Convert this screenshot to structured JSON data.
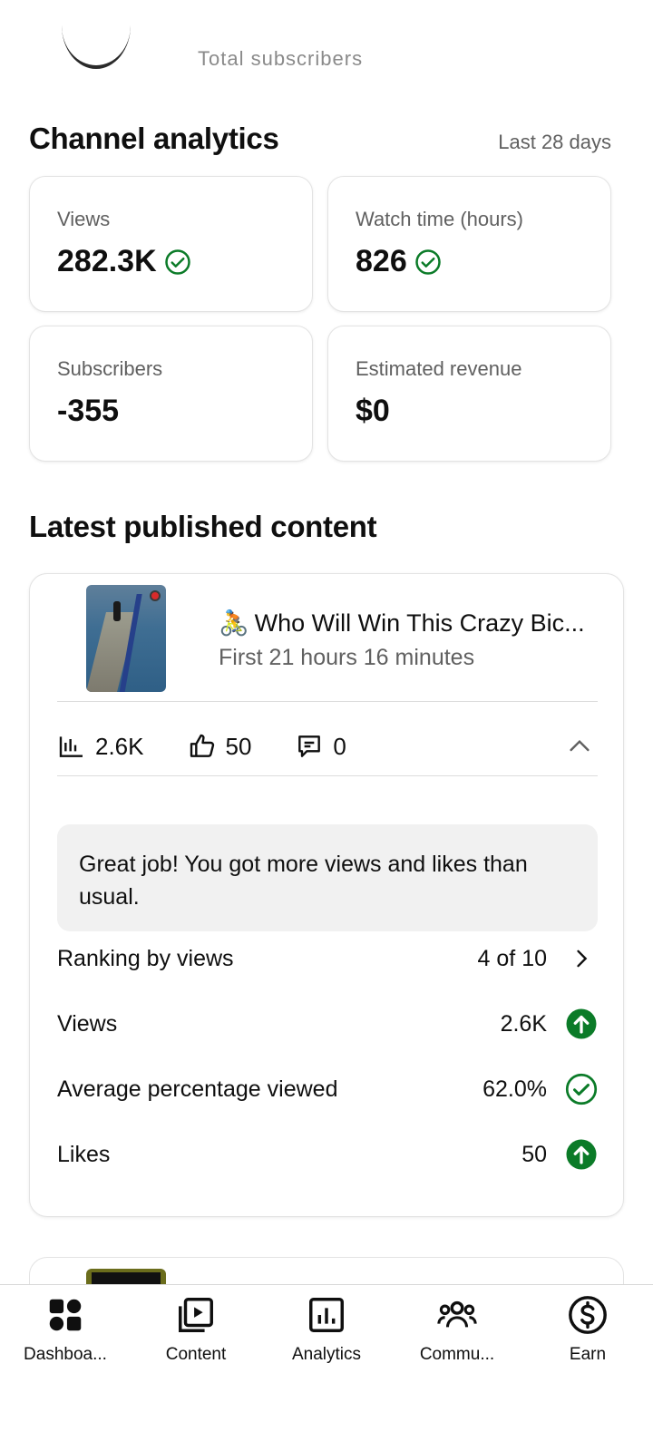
{
  "top": {
    "subtitle_cut": "Total subscribers"
  },
  "analytics": {
    "title": "Channel analytics",
    "range": "Last 28 days",
    "cards": [
      {
        "label": "Views",
        "value": "282.3K",
        "check": true
      },
      {
        "label": "Watch time (hours)",
        "value": "826",
        "check": true
      },
      {
        "label": "Subscribers",
        "value": "-355",
        "check": false
      },
      {
        "label": "Estimated revenue",
        "value": "$0",
        "check": false
      }
    ]
  },
  "latest": {
    "title": "Latest published content",
    "video": {
      "emoji": "🚴",
      "title": "Who Will Win This Crazy Bic...",
      "subtitle": "First 21 hours 16 minutes",
      "views": "2.6K",
      "likes": "50",
      "comments": "0"
    },
    "summary": "Great job! You got more views and likes than usual.",
    "rows": [
      {
        "label": "Ranking by views",
        "value": "4 of 10",
        "icon": "chevron-right-icon"
      },
      {
        "label": "Views",
        "value": "2.6K",
        "icon": "arrow-up-icon"
      },
      {
        "label": "Average percentage viewed",
        "value": "62.0%",
        "icon": "check-circle-icon"
      },
      {
        "label": "Likes",
        "value": "50",
        "icon": "arrow-up-icon"
      }
    ]
  },
  "nav": {
    "items": [
      {
        "label": "Dashboa...",
        "icon": "dashboard-icon"
      },
      {
        "label": "Content",
        "icon": "content-icon"
      },
      {
        "label": "Analytics",
        "icon": "analytics-icon"
      },
      {
        "label": "Commu...",
        "icon": "community-icon"
      },
      {
        "label": "Earn",
        "icon": "earn-icon"
      }
    ]
  },
  "colors": {
    "green": "#0b7b28",
    "text": "#0f0f0f",
    "muted": "#606060"
  }
}
